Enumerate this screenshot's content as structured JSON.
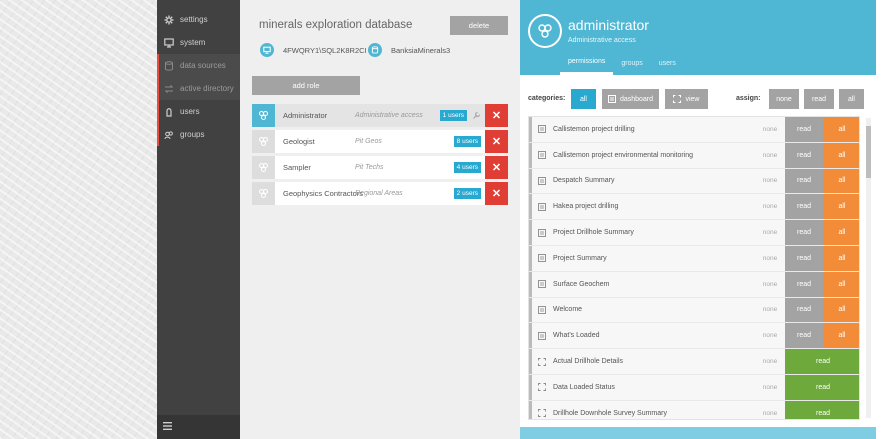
{
  "sidebar": {
    "items": [
      {
        "label": "settings",
        "icon": "gear-icon"
      },
      {
        "label": "system",
        "icon": "monitor-icon"
      },
      {
        "label": "data sources",
        "icon": "database-icon"
      },
      {
        "label": "active directory",
        "icon": "directory-icon"
      },
      {
        "label": "users",
        "icon": "user-icon"
      },
      {
        "label": "groups",
        "icon": "group-icon"
      }
    ],
    "menu_icon": "hamburger-icon"
  },
  "database": {
    "title": "minerals exploration database",
    "delete_label": "delete",
    "server": "4FWQRY1\\SQL2K8R2CI",
    "db_name": "BanksiaMinerals3",
    "add_role_label": "add role"
  },
  "roles": [
    {
      "name": "Administrator",
      "description": "Administrative access",
      "users": "1 users"
    },
    {
      "name": "Geologist",
      "description": "Pit Geos",
      "users": "8 users"
    },
    {
      "name": "Sampler",
      "description": "Pit Techs",
      "users": "4 users"
    },
    {
      "name": "Geophysics Contractors",
      "description": "Regional Areas",
      "users": "2 users"
    }
  ],
  "detail": {
    "title": "administrator",
    "subtitle": "Administrative access",
    "tabs": [
      "permissions",
      "groups",
      "users"
    ],
    "categories_label": "categories:",
    "category_buttons": [
      "all",
      "dashboard",
      "view"
    ],
    "assign_label": "assign:",
    "assign_buttons": [
      "none",
      "read",
      "all"
    ]
  },
  "permissions": [
    {
      "name": "Callistemon project drilling",
      "type": "dashboard",
      "none": "none",
      "read": "read",
      "all": "all"
    },
    {
      "name": "Callistemon project environmental monitoring",
      "type": "dashboard",
      "none": "none",
      "read": "read",
      "all": "all"
    },
    {
      "name": "Despatch Summary",
      "type": "dashboard",
      "none": "none",
      "read": "read",
      "all": "all"
    },
    {
      "name": "Hakea project drilling",
      "type": "dashboard",
      "none": "none",
      "read": "read",
      "all": "all"
    },
    {
      "name": "Project Drillhole Summary",
      "type": "dashboard",
      "none": "none",
      "read": "read",
      "all": "all"
    },
    {
      "name": "Project Summary",
      "type": "dashboard",
      "none": "none",
      "read": "read",
      "all": "all"
    },
    {
      "name": "Surface Geochem",
      "type": "dashboard",
      "none": "none",
      "read": "read",
      "all": "all"
    },
    {
      "name": "Welcome",
      "type": "dashboard",
      "none": "none",
      "read": "read",
      "all": "all"
    },
    {
      "name": "What's Loaded",
      "type": "dashboard",
      "none": "none",
      "read": "read",
      "all": "all"
    },
    {
      "name": "Actual Drillhole Details",
      "type": "view",
      "none": "none",
      "read": "read"
    },
    {
      "name": "Data Loaded Status",
      "type": "view",
      "none": "none",
      "read": "read"
    },
    {
      "name": "Drillhole Downhole Survey Summary",
      "type": "view",
      "none": "none",
      "read": "read"
    }
  ],
  "colors": {
    "accent": "#4fb6d3",
    "badge": "#29a9d0",
    "delete": "#e03e34",
    "all": "#f28c38",
    "read_green": "#6ea93c",
    "grey_button": "#a3a3a3"
  }
}
